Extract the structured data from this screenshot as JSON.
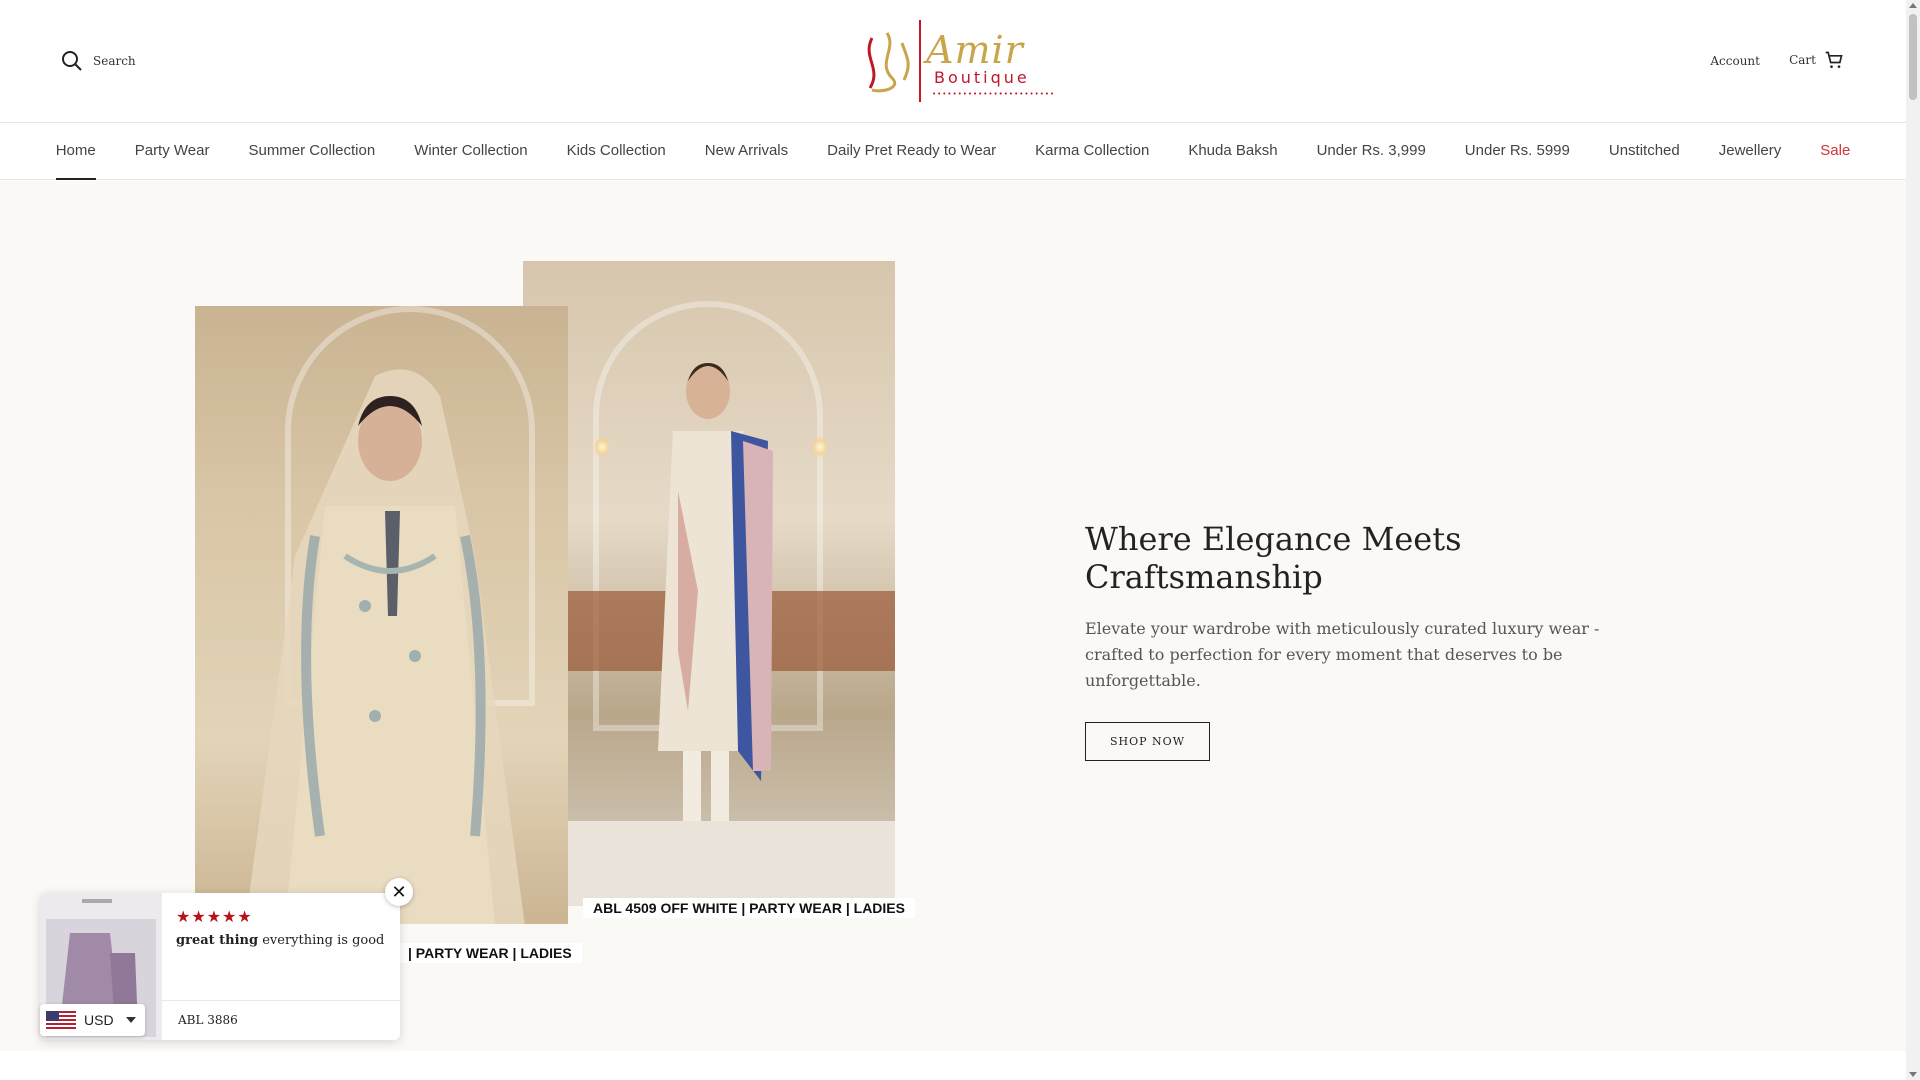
{
  "header": {
    "search_label": "Search",
    "logo_text": "Amir",
    "logo_sub": "Boutique",
    "account_label": "Account",
    "cart_label": "Cart"
  },
  "nav": {
    "items": [
      {
        "label": "Home",
        "active": true
      },
      {
        "label": "Party Wear"
      },
      {
        "label": "Summer Collection"
      },
      {
        "label": "Winter Collection"
      },
      {
        "label": "Kids Collection"
      },
      {
        "label": "New Arrivals"
      },
      {
        "label": "Daily Pret Ready to Wear"
      },
      {
        "label": "Karma Collection"
      },
      {
        "label": "Khuda Baksh"
      },
      {
        "label": "Under Rs. 3,999"
      },
      {
        "label": "Under Rs. 5999"
      },
      {
        "label": "Unstitched"
      },
      {
        "label": "Jewellery"
      },
      {
        "label": "Sale",
        "color": "#d0343a"
      }
    ]
  },
  "hero": {
    "caption_back": "ABL 4509 OFF WHITE | PARTY WEAR | LADIES",
    "caption_front": "| PARTY WEAR | LADIES",
    "title": "Where Elegance Meets Craftsmanship",
    "subtitle": "Elevate your wardrobe with meticulously curated luxury wear - crafted to perfection for every moment that deserves to be unforgettable.",
    "button_label": "SHOP NOW"
  },
  "review": {
    "stars": "★★★★★",
    "title": "great thing",
    "body": " everything is good",
    "product": "ABL 3886",
    "close_icon": "✕"
  },
  "currency": {
    "code": "USD",
    "flag": "us-flag-icon"
  },
  "colors": {
    "accent_sale": "#d0343a",
    "stars": "#b5121b",
    "hero_bg": "#fbf9f5"
  }
}
